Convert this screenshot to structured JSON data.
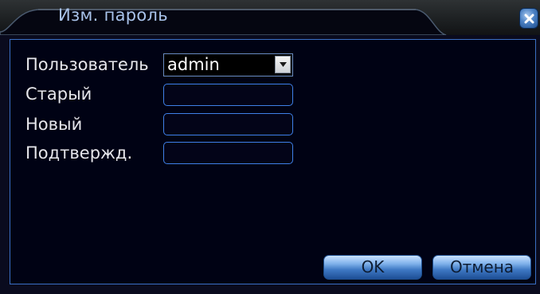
{
  "dialog": {
    "title": "Изм. пароль",
    "close_icon": "close-icon"
  },
  "form": {
    "user_label": "Пользователь",
    "user_value": "admin",
    "old_label": "Старый",
    "old_value": "",
    "new_label": "Новый",
    "new_value": "",
    "confirm_label": "Подтвержд.",
    "confirm_value": ""
  },
  "buttons": {
    "ok_label": "OK",
    "cancel_label": "Отмена"
  },
  "colors": {
    "title_text": "#a9c3ea",
    "field_border": "#3f80e8",
    "button_blue": "#3f79c4"
  }
}
